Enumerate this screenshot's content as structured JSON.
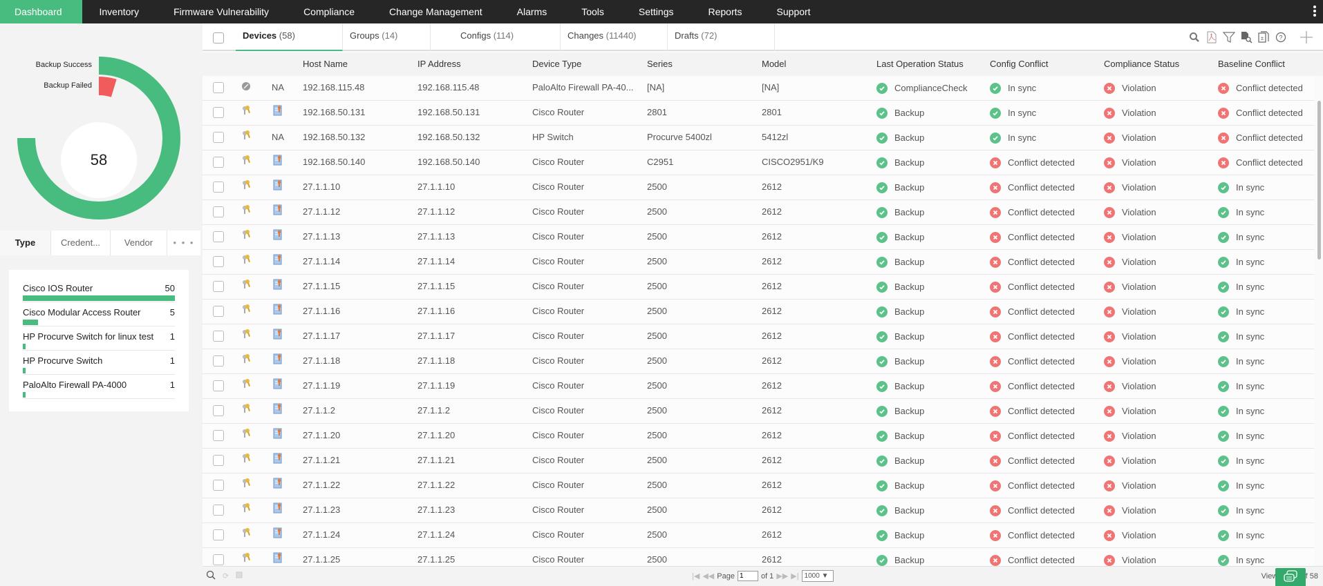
{
  "nav": {
    "items": [
      "Dashboard",
      "Inventory",
      "Firmware Vulnerability",
      "Compliance",
      "Change Management",
      "Alarms",
      "Tools",
      "Settings",
      "Reports",
      "Support"
    ],
    "active": "Dashboard"
  },
  "donut": {
    "total": "58",
    "legend": [
      {
        "label": "Backup Success",
        "value": 55,
        "color": "#47bc7e"
      },
      {
        "label": "Backup Failed",
        "value": 3,
        "color": "#f25b5b"
      }
    ]
  },
  "left_tabs": [
    "Type",
    "Credent...",
    "Vendor",
    "• • •"
  ],
  "type_list": [
    {
      "name": "Cisco IOS Router",
      "count": "50",
      "value": 50
    },
    {
      "name": "Cisco Modular Access Router",
      "count": "5",
      "value": 5
    },
    {
      "name": "HP Procurve Switch for linux test",
      "count": "1",
      "value": 1
    },
    {
      "name": "HP Procurve Switch",
      "count": "1",
      "value": 1
    },
    {
      "name": "PaloAlto Firewall PA-4000",
      "count": "1",
      "value": 1
    }
  ],
  "tabs": [
    {
      "label": "Devices",
      "count": "(58)"
    },
    {
      "label": "Groups",
      "count": "(14)"
    },
    {
      "label": "Configs",
      "count": "(114)"
    },
    {
      "label": "Changes",
      "count": "(11440)"
    },
    {
      "label": "Drafts",
      "count": "(72)"
    }
  ],
  "toolbar_icons": [
    "search-icon",
    "pdf-export-icon",
    "filter-icon",
    "config-search-icon",
    "compare-icon",
    "help-icon",
    "add-icon"
  ],
  "columns": [
    "Host Name",
    "IP Address",
    "Device Type",
    "Series",
    "Model",
    "Last Operation Status",
    "Config Conflict",
    "Compliance Status",
    "Baseline Conflict"
  ],
  "rows": [
    {
      "icon": "disabled",
      "label": "NA",
      "host": "192.168.115.48",
      "ip": "192.168.115.48",
      "type": "PaloAlto Firewall PA-40...",
      "series": "[NA]",
      "model": "[NA]",
      "op": [
        "ok",
        "ComplianceCheck"
      ],
      "conf": [
        "ok",
        "In sync"
      ],
      "comp": [
        "bad",
        "Violation"
      ],
      "base": [
        "bad",
        "Conflict detected"
      ]
    },
    {
      "icon": "key",
      "label": "cert",
      "host": "192.168.50.131",
      "ip": "192.168.50.131",
      "type": "Cisco Router",
      "series": "2801",
      "model": "2801",
      "op": [
        "ok",
        "Backup"
      ],
      "conf": [
        "ok",
        "In sync"
      ],
      "comp": [
        "bad",
        "Violation"
      ],
      "base": [
        "bad",
        "Conflict detected"
      ]
    },
    {
      "icon": "key",
      "label": "NA",
      "host": "192.168.50.132",
      "ip": "192.168.50.132",
      "type": "HP Switch",
      "series": "Procurve 5400zl",
      "model": "5412zl",
      "op": [
        "ok",
        "Backup"
      ],
      "conf": [
        "ok",
        "In sync"
      ],
      "comp": [
        "bad",
        "Violation"
      ],
      "base": [
        "bad",
        "Conflict detected"
      ]
    },
    {
      "icon": "key",
      "label": "cert",
      "host": "192.168.50.140",
      "ip": "192.168.50.140",
      "type": "Cisco Router",
      "series": "C2951",
      "model": "CISCO2951/K9",
      "op": [
        "ok",
        "Backup"
      ],
      "conf": [
        "bad",
        "Conflict detected"
      ],
      "comp": [
        "bad",
        "Violation"
      ],
      "base": [
        "bad",
        "Conflict detected"
      ]
    },
    {
      "icon": "key",
      "label": "cert",
      "host": "27.1.1.10",
      "ip": "27.1.1.10",
      "type": "Cisco Router",
      "series": "2500",
      "model": "2612",
      "op": [
        "ok",
        "Backup"
      ],
      "conf": [
        "bad",
        "Conflict detected"
      ],
      "comp": [
        "bad",
        "Violation"
      ],
      "base": [
        "ok",
        "In sync"
      ]
    },
    {
      "icon": "key",
      "label": "cert",
      "host": "27.1.1.12",
      "ip": "27.1.1.12",
      "type": "Cisco Router",
      "series": "2500",
      "model": "2612",
      "op": [
        "ok",
        "Backup"
      ],
      "conf": [
        "bad",
        "Conflict detected"
      ],
      "comp": [
        "bad",
        "Violation"
      ],
      "base": [
        "ok",
        "In sync"
      ]
    },
    {
      "icon": "key",
      "label": "cert",
      "host": "27.1.1.13",
      "ip": "27.1.1.13",
      "type": "Cisco Router",
      "series": "2500",
      "model": "2612",
      "op": [
        "ok",
        "Backup"
      ],
      "conf": [
        "bad",
        "Conflict detected"
      ],
      "comp": [
        "bad",
        "Violation"
      ],
      "base": [
        "ok",
        "In sync"
      ]
    },
    {
      "icon": "key",
      "label": "cert",
      "host": "27.1.1.14",
      "ip": "27.1.1.14",
      "type": "Cisco Router",
      "series": "2500",
      "model": "2612",
      "op": [
        "ok",
        "Backup"
      ],
      "conf": [
        "bad",
        "Conflict detected"
      ],
      "comp": [
        "bad",
        "Violation"
      ],
      "base": [
        "ok",
        "In sync"
      ]
    },
    {
      "icon": "key",
      "label": "cert",
      "host": "27.1.1.15",
      "ip": "27.1.1.15",
      "type": "Cisco Router",
      "series": "2500",
      "model": "2612",
      "op": [
        "ok",
        "Backup"
      ],
      "conf": [
        "bad",
        "Conflict detected"
      ],
      "comp": [
        "bad",
        "Violation"
      ],
      "base": [
        "ok",
        "In sync"
      ]
    },
    {
      "icon": "key",
      "label": "cert",
      "host": "27.1.1.16",
      "ip": "27.1.1.16",
      "type": "Cisco Router",
      "series": "2500",
      "model": "2612",
      "op": [
        "ok",
        "Backup"
      ],
      "conf": [
        "bad",
        "Conflict detected"
      ],
      "comp": [
        "bad",
        "Violation"
      ],
      "base": [
        "ok",
        "In sync"
      ]
    },
    {
      "icon": "key",
      "label": "cert",
      "host": "27.1.1.17",
      "ip": "27.1.1.17",
      "type": "Cisco Router",
      "series": "2500",
      "model": "2612",
      "op": [
        "ok",
        "Backup"
      ],
      "conf": [
        "bad",
        "Conflict detected"
      ],
      "comp": [
        "bad",
        "Violation"
      ],
      "base": [
        "ok",
        "In sync"
      ]
    },
    {
      "icon": "key",
      "label": "cert",
      "host": "27.1.1.18",
      "ip": "27.1.1.18",
      "type": "Cisco Router",
      "series": "2500",
      "model": "2612",
      "op": [
        "ok",
        "Backup"
      ],
      "conf": [
        "bad",
        "Conflict detected"
      ],
      "comp": [
        "bad",
        "Violation"
      ],
      "base": [
        "ok",
        "In sync"
      ]
    },
    {
      "icon": "key",
      "label": "cert",
      "host": "27.1.1.19",
      "ip": "27.1.1.19",
      "type": "Cisco Router",
      "series": "2500",
      "model": "2612",
      "op": [
        "ok",
        "Backup"
      ],
      "conf": [
        "bad",
        "Conflict detected"
      ],
      "comp": [
        "bad",
        "Violation"
      ],
      "base": [
        "ok",
        "In sync"
      ]
    },
    {
      "icon": "key",
      "label": "cert",
      "host": "27.1.1.2",
      "ip": "27.1.1.2",
      "type": "Cisco Router",
      "series": "2500",
      "model": "2612",
      "op": [
        "ok",
        "Backup"
      ],
      "conf": [
        "bad",
        "Conflict detected"
      ],
      "comp": [
        "bad",
        "Violation"
      ],
      "base": [
        "ok",
        "In sync"
      ]
    },
    {
      "icon": "key",
      "label": "cert",
      "host": "27.1.1.20",
      "ip": "27.1.1.20",
      "type": "Cisco Router",
      "series": "2500",
      "model": "2612",
      "op": [
        "ok",
        "Backup"
      ],
      "conf": [
        "bad",
        "Conflict detected"
      ],
      "comp": [
        "bad",
        "Violation"
      ],
      "base": [
        "ok",
        "In sync"
      ]
    },
    {
      "icon": "key",
      "label": "cert",
      "host": "27.1.1.21",
      "ip": "27.1.1.21",
      "type": "Cisco Router",
      "series": "2500",
      "model": "2612",
      "op": [
        "ok",
        "Backup"
      ],
      "conf": [
        "bad",
        "Conflict detected"
      ],
      "comp": [
        "bad",
        "Violation"
      ],
      "base": [
        "ok",
        "In sync"
      ]
    },
    {
      "icon": "key",
      "label": "cert",
      "host": "27.1.1.22",
      "ip": "27.1.1.22",
      "type": "Cisco Router",
      "series": "2500",
      "model": "2612",
      "op": [
        "ok",
        "Backup"
      ],
      "conf": [
        "bad",
        "Conflict detected"
      ],
      "comp": [
        "bad",
        "Violation"
      ],
      "base": [
        "ok",
        "In sync"
      ]
    },
    {
      "icon": "key",
      "label": "cert",
      "host": "27.1.1.23",
      "ip": "27.1.1.23",
      "type": "Cisco Router",
      "series": "2500",
      "model": "2612",
      "op": [
        "ok",
        "Backup"
      ],
      "conf": [
        "bad",
        "Conflict detected"
      ],
      "comp": [
        "bad",
        "Violation"
      ],
      "base": [
        "ok",
        "In sync"
      ]
    },
    {
      "icon": "key",
      "label": "cert",
      "host": "27.1.1.24",
      "ip": "27.1.1.24",
      "type": "Cisco Router",
      "series": "2500",
      "model": "2612",
      "op": [
        "ok",
        "Backup"
      ],
      "conf": [
        "bad",
        "Conflict detected"
      ],
      "comp": [
        "bad",
        "Violation"
      ],
      "base": [
        "ok",
        "In sync"
      ]
    },
    {
      "icon": "key",
      "label": "cert",
      "host": "27.1.1.25",
      "ip": "27.1.1.25",
      "type": "Cisco Router",
      "series": "2500",
      "model": "2612",
      "op": [
        "ok",
        "Backup"
      ],
      "conf": [
        "bad",
        "Conflict detected"
      ],
      "comp": [
        "bad",
        "Violation"
      ],
      "base": [
        "ok",
        "In sync"
      ]
    }
  ],
  "footer": {
    "page_label": "Page",
    "page_value": "1",
    "of_label": "of 1",
    "page_size": "1000 ▼",
    "view_text": "View 1 - 58 of 58"
  },
  "colors": {
    "accent": "#47bc7e",
    "ok": "#5cc28a",
    "bad": "#f07474",
    "nav_bg": "#262626"
  }
}
